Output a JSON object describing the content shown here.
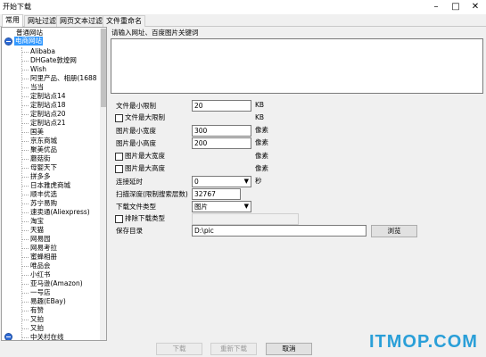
{
  "window": {
    "title": "开始下载"
  },
  "tabs": [
    "常用",
    "网址过滤",
    "网页文本过滤",
    "文件重命名"
  ],
  "tree": {
    "root_label": "普通网站",
    "category_label": "电商网站",
    "items": [
      "Alibaba",
      "DHGate敦煌网",
      "Wish",
      "阿里产品、相册(1688",
      "当当",
      "定制站点14",
      "定制站点18",
      "定制站点20",
      "定制站点21",
      "国美",
      "京东商城",
      "聚美优品",
      "蘑菇街",
      "母婴天下",
      "拼多多",
      "日本雅虎商城",
      "顺丰优选",
      "苏宁易购",
      "速卖通(Aliexpress)",
      "淘宝",
      "天猫",
      "网易园",
      "网易考拉",
      "蜜蜂相册",
      "唯品会",
      "小红书",
      "亚马逊(Amazon)",
      "一号店",
      "易趣(EBay)",
      "有赞",
      "又拍",
      "又拍",
      "中关村在线"
    ]
  },
  "form": {
    "url_prompt": "请输入网址、百度图片关键词",
    "file_min_label": "文件最小限制",
    "file_min_value": "20",
    "file_min_unit": "KB",
    "file_max_label": "文件最大限制",
    "file_max_unit": "KB",
    "img_min_w_label": "图片最小宽度",
    "img_min_w_value": "300",
    "img_min_w_unit": "像素",
    "img_min_h_label": "图片最小高度",
    "img_min_h_value": "200",
    "img_min_h_unit": "像素",
    "img_max_w_label": "图片最大宽度",
    "img_max_w_unit": "像素",
    "img_max_h_label": "图片最大高度",
    "img_max_h_unit": "像素",
    "delay_label": "连接延时",
    "delay_value": "0",
    "delay_unit": "秒",
    "depth_label": "扫描深度(限制搜索层数)",
    "depth_value": "32767",
    "filetype_label": "下载文件类型",
    "filetype_value": "图片",
    "exclude_label": "排除下载类型",
    "save_label": "保存目录",
    "save_value": "D:\\pic",
    "browse_label": "浏览"
  },
  "footer": {
    "download_label": "下载",
    "redownload_label": "重新下载",
    "cancel_label": "取消"
  },
  "watermark": "ITMOP.COM",
  "colors": {
    "selection": "#3399ff",
    "watermark": "#2a9fd8",
    "expander": "#2f6bd6"
  }
}
